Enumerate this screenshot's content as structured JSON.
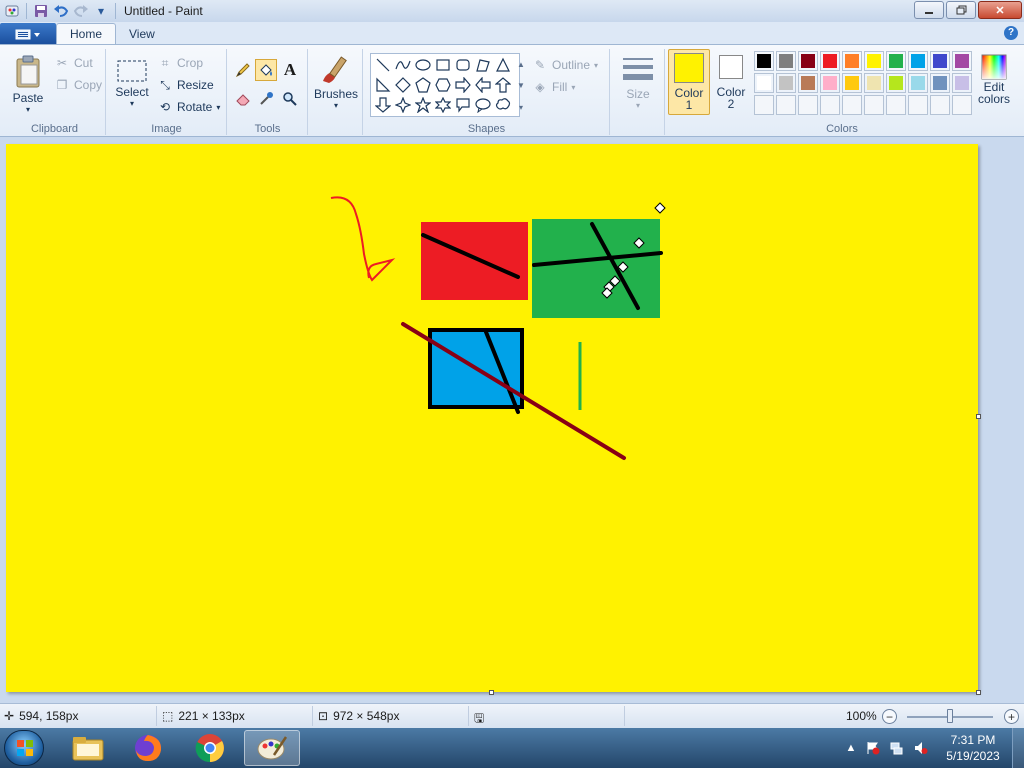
{
  "window": {
    "title": "Untitled - Paint",
    "buttons": [
      "minimize",
      "maximize",
      "close"
    ]
  },
  "quick_access": {
    "icons": [
      "paint-app-icon",
      "save-icon",
      "undo-icon",
      "redo-icon",
      "customize-dropdown-icon"
    ]
  },
  "ribbon_tabs": [
    {
      "label": "Home",
      "active": true
    },
    {
      "label": "View",
      "active": false
    }
  ],
  "clipboard": {
    "paste": "Paste",
    "cut": "Cut",
    "copy": "Copy",
    "label": "Clipboard"
  },
  "image": {
    "select": "Select",
    "crop": "Crop",
    "resize": "Resize",
    "rotate": "Rotate",
    "label": "Image"
  },
  "tools": {
    "label": "Tools",
    "items": [
      "pencil-icon",
      "fill-bucket-icon",
      "text-icon",
      "eraser-icon",
      "color-picker-icon",
      "magnifier-icon"
    ],
    "active": "fill-bucket-icon"
  },
  "brushes": {
    "label": "Brushes"
  },
  "shapes": {
    "label": "Shapes",
    "outline": "Outline",
    "fill": "Fill"
  },
  "size": {
    "label": "Size"
  },
  "color1": {
    "label": "Color\n1",
    "line1": "Color",
    "line2": "1",
    "value": "#fff200"
  },
  "color2": {
    "label": "Color 2",
    "line1": "Color",
    "line2": "2",
    "value": "#ffffff"
  },
  "colors": {
    "label": "Colors",
    "row1": [
      "#000000",
      "#7f7f7f",
      "#880015",
      "#ed1c24",
      "#ff7f27",
      "#fff200",
      "#22b14c",
      "#00a2e8",
      "#3f48cc",
      "#a349a4"
    ],
    "row2": [
      "#ffffff",
      "#c3c3c3",
      "#b97a57",
      "#ffaec9",
      "#ffc90e",
      "#efe4b0",
      "#b5e61d",
      "#99d9ea",
      "#7092be",
      "#c8bfe7"
    ],
    "row3": [
      "",
      "",
      "",
      "",
      "",
      "",
      "",
      "",
      "",
      ""
    ]
  },
  "edit_colors": {
    "line1": "Edit",
    "line2": "colors"
  },
  "canvas": {
    "background": "#fff200",
    "red_rect": "#ed1c24",
    "green_rect": "#22b14c",
    "blue_rect": "#00a2e8",
    "dark_red_line": "#880015",
    "green_line": "#22b14c",
    "red_scribble": "#ed1c24"
  },
  "status": {
    "cursor_pos": "594, 158px",
    "selection_size": "221 × 133px",
    "canvas_size": "972 × 548px",
    "zoom": "100%"
  },
  "taskbar": {
    "apps": [
      "windows-explorer-icon",
      "firefox-icon",
      "chrome-icon",
      "paint-icon"
    ],
    "time": "7:31 PM",
    "date": "5/19/2023"
  }
}
